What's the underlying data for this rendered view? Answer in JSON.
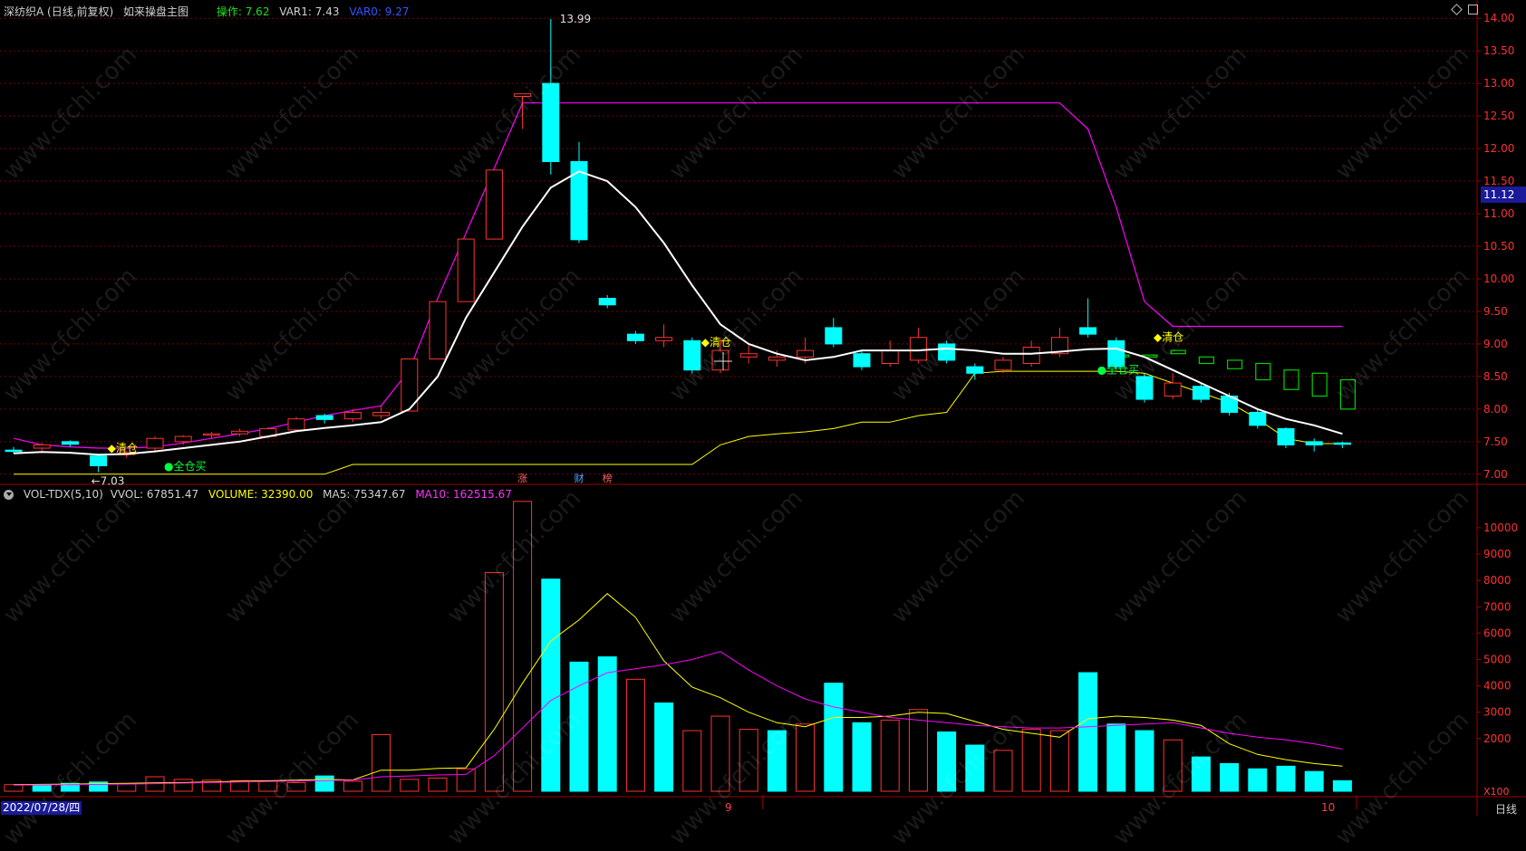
{
  "top_bar": {
    "stock_title": "深纺织A (日线,前复权)",
    "indicator_name": "如来操盘主图",
    "op_label": "操作: 7.62",
    "var1_label": "VAR1: 7.43",
    "var0_label": "VAR0: 9.27"
  },
  "volume_bar": {
    "name": "VOL-TDX(5,10)",
    "vvol_label": "VVOL: 67851.47",
    "volume_label": "VOLUME: 32390.00",
    "ma5_label": "MA5: 75347.67",
    "ma10_label": "MA10: 162515.67"
  },
  "bottom": {
    "date_label": "2022/07/28/四",
    "period_label": "日线",
    "multiplier_label": "X100",
    "month_9": "9",
    "month_10": "10"
  },
  "current_price_tag": "11.12",
  "watermark_text": "www.cfchi.com",
  "colors": {
    "up": "#ff3232",
    "down": "#00ffff",
    "white_line": "#ffffff",
    "magenta": "#ff00ff",
    "yellow": "#ffff00",
    "green": "#00d000",
    "grid": "#7a0000",
    "axis": "#a00000"
  },
  "chart_data": [
    {
      "type": "candlestick",
      "title": "深纺织A (日线,前复权)",
      "ylim": [
        6.9,
        14.1
      ],
      "y_ticks": [
        7.0,
        7.5,
        8.0,
        8.5,
        9.0,
        9.5,
        10.0,
        10.5,
        11.0,
        11.5,
        12.0,
        12.5,
        13.0,
        13.5,
        14.0
      ],
      "candles": [
        {
          "o": 7.37,
          "c": 7.35,
          "h": 7.42,
          "l": 7.32
        },
        {
          "o": 7.4,
          "c": 7.45,
          "h": 7.48,
          "l": 7.36
        },
        {
          "o": 7.5,
          "c": 7.46,
          "h": 7.52,
          "l": 7.42
        },
        {
          "o": 7.28,
          "c": 7.13,
          "h": 7.3,
          "l": 7.03
        },
        {
          "o": 7.3,
          "c": 7.33,
          "h": 7.36,
          "l": 7.25
        },
        {
          "o": 7.4,
          "c": 7.55,
          "h": 7.58,
          "l": 7.36
        },
        {
          "o": 7.5,
          "c": 7.58,
          "h": 7.6,
          "l": 7.45
        },
        {
          "o": 7.6,
          "c": 7.62,
          "h": 7.65,
          "l": 7.55
        },
        {
          "o": 7.62,
          "c": 7.66,
          "h": 7.7,
          "l": 7.58
        },
        {
          "o": 7.58,
          "c": 7.7,
          "h": 7.72,
          "l": 7.55
        },
        {
          "o": 7.68,
          "c": 7.85,
          "h": 7.88,
          "l": 7.65
        },
        {
          "o": 7.9,
          "c": 7.84,
          "h": 7.93,
          "l": 7.78
        },
        {
          "o": 7.85,
          "c": 7.95,
          "h": 8.0,
          "l": 7.8
        },
        {
          "o": 7.9,
          "c": 7.95,
          "h": 8.05,
          "l": 7.85
        },
        {
          "o": 7.97,
          "c": 8.77,
          "h": 8.77,
          "l": 7.97
        },
        {
          "o": 8.77,
          "c": 9.65,
          "h": 9.65,
          "l": 8.77
        },
        {
          "o": 9.65,
          "c": 10.61,
          "h": 10.61,
          "l": 9.65
        },
        {
          "o": 10.61,
          "c": 11.67,
          "h": 11.67,
          "l": 10.61
        },
        {
          "o": 12.8,
          "c": 12.84,
          "h": 12.84,
          "l": 12.3
        },
        {
          "o": 13.0,
          "c": 11.8,
          "h": 13.99,
          "l": 11.6
        },
        {
          "o": 11.8,
          "c": 10.6,
          "h": 12.1,
          "l": 10.55
        },
        {
          "o": 9.7,
          "c": 9.6,
          "h": 9.75,
          "l": 9.55
        },
        {
          "o": 9.15,
          "c": 9.05,
          "h": 9.2,
          "l": 9.0
        },
        {
          "o": 9.05,
          "c": 9.1,
          "h": 9.3,
          "l": 8.95
        },
        {
          "o": 9.05,
          "c": 8.6,
          "h": 9.1,
          "l": 8.55
        },
        {
          "o": 8.6,
          "c": 8.9,
          "h": 9.1,
          "l": 8.55
        },
        {
          "o": 8.8,
          "c": 8.85,
          "h": 9.0,
          "l": 8.7
        },
        {
          "o": 8.75,
          "c": 8.8,
          "h": 8.9,
          "l": 8.65
        },
        {
          "o": 8.8,
          "c": 8.9,
          "h": 9.1,
          "l": 8.7
        },
        {
          "o": 9.25,
          "c": 9.0,
          "h": 9.4,
          "l": 8.95
        },
        {
          "o": 8.85,
          "c": 8.65,
          "h": 8.9,
          "l": 8.6
        },
        {
          "o": 8.7,
          "c": 8.9,
          "h": 9.05,
          "l": 8.65
        },
        {
          "o": 8.75,
          "c": 9.1,
          "h": 9.25,
          "l": 8.7
        },
        {
          "o": 9.0,
          "c": 8.75,
          "h": 9.05,
          "l": 8.7
        },
        {
          "o": 8.65,
          "c": 8.55,
          "h": 8.7,
          "l": 8.45
        },
        {
          "o": 8.6,
          "c": 8.75,
          "h": 8.8,
          "l": 8.55
        },
        {
          "o": 8.7,
          "c": 8.95,
          "h": 9.05,
          "l": 8.65
        },
        {
          "o": 8.85,
          "c": 9.1,
          "h": 9.25,
          "l": 8.8
        },
        {
          "o": 9.25,
          "c": 9.15,
          "h": 9.7,
          "l": 9.1
        },
        {
          "o": 9.05,
          "c": 8.65,
          "h": 9.1,
          "l": 8.6
        },
        {
          "o": 8.5,
          "c": 8.15,
          "h": 8.55,
          "l": 8.1
        },
        {
          "o": 8.2,
          "c": 8.4,
          "h": 8.55,
          "l": 8.15
        },
        {
          "o": 8.35,
          "c": 8.15,
          "h": 8.4,
          "l": 8.1
        },
        {
          "o": 8.2,
          "c": 7.95,
          "h": 8.25,
          "l": 7.9
        },
        {
          "o": 7.95,
          "c": 7.75,
          "h": 8.0,
          "l": 7.7
        },
        {
          "o": 7.7,
          "c": 7.45,
          "h": 7.72,
          "l": 7.4
        },
        {
          "o": 7.5,
          "c": 7.45,
          "h": 7.55,
          "l": 7.35
        },
        {
          "o": 7.48,
          "c": 7.46,
          "h": 7.5,
          "l": 7.4
        }
      ],
      "white_line": [
        7.32,
        7.34,
        7.33,
        7.3,
        7.31,
        7.35,
        7.4,
        7.45,
        7.5,
        7.58,
        7.66,
        7.71,
        7.75,
        7.8,
        8.0,
        8.5,
        9.4,
        10.1,
        10.8,
        11.4,
        11.65,
        11.5,
        11.1,
        10.55,
        9.9,
        9.3,
        9.0,
        8.85,
        8.75,
        8.8,
        8.9,
        8.9,
        8.9,
        8.93,
        8.9,
        8.85,
        8.85,
        8.88,
        8.92,
        8.93,
        8.8,
        8.6,
        8.4,
        8.2,
        8.0,
        7.85,
        7.75,
        7.62
      ],
      "magenta_line": [
        7.55,
        7.45,
        7.42,
        7.4,
        7.4,
        7.42,
        7.48,
        7.55,
        7.62,
        7.7,
        7.8,
        7.9,
        7.98,
        8.05,
        8.6,
        9.7,
        10.7,
        11.7,
        12.7,
        12.7,
        12.7,
        12.7,
        12.7,
        12.7,
        12.7,
        12.7,
        12.7,
        12.7,
        12.7,
        12.7,
        12.7,
        12.7,
        12.7,
        12.7,
        12.7,
        12.7,
        12.7,
        12.7,
        12.3,
        11.1,
        9.65,
        9.27,
        9.27,
        9.27,
        9.27,
        9.27,
        9.27,
        9.27
      ],
      "yellow_line": [
        7.0,
        7.0,
        7.0,
        7.0,
        7.0,
        7.0,
        7.0,
        7.0,
        7.0,
        7.0,
        7.0,
        7.0,
        7.15,
        7.15,
        7.15,
        7.15,
        7.15,
        7.15,
        7.15,
        7.15,
        7.15,
        7.15,
        7.15,
        7.15,
        7.15,
        7.45,
        7.58,
        7.62,
        7.65,
        7.7,
        7.8,
        7.8,
        7.9,
        7.95,
        8.55,
        8.58,
        8.58,
        8.58,
        8.58,
        8.58,
        8.55,
        8.4,
        8.25,
        8.1,
        7.85,
        7.55,
        7.47,
        7.47
      ],
      "projected_green_boxes": [
        {
          "lo": 8.82,
          "hi": 8.83
        },
        {
          "lo": 8.8,
          "hi": 8.83
        },
        {
          "lo": 8.85,
          "hi": 8.9
        },
        {
          "lo": 8.7,
          "hi": 8.8
        },
        {
          "lo": 8.62,
          "hi": 8.75
        },
        {
          "lo": 8.45,
          "hi": 8.7
        },
        {
          "lo": 8.3,
          "hi": 8.6
        },
        {
          "lo": 8.2,
          "hi": 8.55
        },
        {
          "lo": 8.0,
          "hi": 8.45
        }
      ],
      "annotations": [
        {
          "text": "13.99",
          "value": 13.99,
          "index": 19
        },
        {
          "text": "7.03",
          "value": 7.03,
          "index": 3
        },
        {
          "text": "◆清仓",
          "value": 7.4,
          "index": 3
        },
        {
          "text": "●全仓买",
          "value": 7.12,
          "index": 5
        },
        {
          "text": "◆清仓",
          "value": 9.03,
          "index": 24
        },
        {
          "text": "●全仓买",
          "value": 8.6,
          "index": 38
        },
        {
          "text": "◆清仓",
          "value": 9.1,
          "index": 40
        }
      ],
      "event_tags": [
        {
          "text": "涨",
          "index": 18
        },
        {
          "text": "财",
          "index": 20
        },
        {
          "text": "榜",
          "index": 21
        }
      ]
    },
    {
      "type": "bar",
      "title": "VOL-TDX(5,10)",
      "ylabel": "X100",
      "ylim": [
        0,
        11200
      ],
      "y_ticks": [
        2000,
        3000,
        4000,
        5000,
        6000,
        7000,
        8000,
        9000,
        10000
      ],
      "values": [
        250,
        250,
        300,
        350,
        280,
        550,
        450,
        420,
        400,
        380,
        330,
        580,
        380,
        2150,
        450,
        500,
        850,
        8300,
        11000,
        8050,
        4900,
        5100,
        4250,
        3350,
        2300,
        2850,
        2350,
        2300,
        2550,
        4100,
        2600,
        2700,
        3100,
        2250,
        1750,
        1550,
        2350,
        2300,
        4500,
        2550,
        2300,
        1950,
        1300,
        1050,
        850,
        950,
        750,
        400
      ],
      "up": [
        true,
        false,
        false,
        false,
        true,
        true,
        true,
        true,
        true,
        true,
        true,
        false,
        true,
        true,
        true,
        true,
        true,
        true,
        true,
        false,
        false,
        false,
        true,
        false,
        true,
        true,
        true,
        false,
        true,
        false,
        false,
        true,
        true,
        false,
        false,
        true,
        true,
        true,
        false,
        false,
        false,
        true,
        false,
        false,
        false,
        false,
        false,
        false
      ],
      "ma5": [
        250,
        260,
        270,
        290,
        300,
        320,
        330,
        350,
        380,
        400,
        420,
        450,
        430,
        800,
        800,
        870,
        890,
        2350,
        4100,
        5700,
        6500,
        7500,
        6600,
        4950,
        3950,
        3550,
        3000,
        2600,
        2450,
        2800,
        2800,
        2850,
        3000,
        2950,
        2650,
        2350,
        2200,
        2050,
        2750,
        2850,
        2800,
        2700,
        2500,
        1800,
        1400,
        1200,
        1050,
        950
      ],
      "ma10": [
        230,
        240,
        250,
        260,
        270,
        290,
        310,
        330,
        350,
        370,
        390,
        410,
        420,
        550,
        580,
        620,
        640,
        1350,
        2400,
        3450,
        4000,
        4500,
        4650,
        4800,
        5000,
        5300,
        4600,
        4000,
        3500,
        3200,
        3000,
        2800,
        2700,
        2600,
        2500,
        2450,
        2400,
        2400,
        2450,
        2500,
        2550,
        2600,
        2400,
        2200,
        2050,
        1950,
        1800,
        1600
      ]
    }
  ]
}
